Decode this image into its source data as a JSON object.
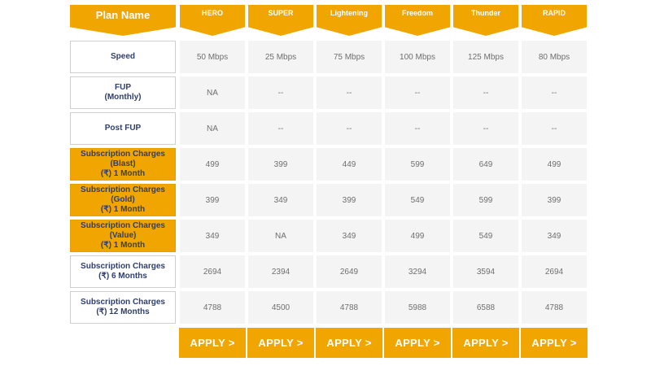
{
  "header": {
    "plan_name": "Plan Name",
    "plans": [
      "HERO",
      "SUPER",
      "Lightening",
      "Freedom",
      "Thunder",
      "RAPID"
    ]
  },
  "rows": [
    {
      "label": [
        "Speed"
      ],
      "highlight": false,
      "values": [
        "50 Mbps",
        "25 Mbps",
        "75 Mbps",
        "100 Mbps",
        "125 Mbps",
        "80 Mbps"
      ]
    },
    {
      "label": [
        "FUP",
        "(Monthly)"
      ],
      "highlight": false,
      "values": [
        "NA",
        "--",
        "--",
        "--",
        "--",
        "--"
      ]
    },
    {
      "label": [
        "Post FUP"
      ],
      "highlight": false,
      "values": [
        "NA",
        "--",
        "--",
        "--",
        "--",
        "--"
      ]
    },
    {
      "label": [
        "Subscription Charges",
        "(Blast)",
        "(₹) 1 Month"
      ],
      "highlight": true,
      "values": [
        "499",
        "399",
        "449",
        "599",
        "649",
        "499"
      ]
    },
    {
      "label": [
        "Subscription Charges",
        "(Gold)",
        "(₹) 1 Month"
      ],
      "highlight": true,
      "values": [
        "399",
        "349",
        "399",
        "549",
        "599",
        "399"
      ]
    },
    {
      "label": [
        "Subscription Charges",
        "(Value)",
        "(₹) 1 Month"
      ],
      "highlight": true,
      "values": [
        "349",
        "NA",
        "349",
        "499",
        "549",
        "349"
      ]
    },
    {
      "label": [
        "Subscription Charges",
        "(₹) 6 Months"
      ],
      "highlight": false,
      "values": [
        "2694",
        "2394",
        "2649",
        "3294",
        "3594",
        "2694"
      ]
    },
    {
      "label": [
        "Subscription Charges",
        "(₹) 12 Months"
      ],
      "highlight": false,
      "values": [
        "4788",
        "4500",
        "4788",
        "5988",
        "6588",
        "4788"
      ]
    }
  ],
  "apply_label": "APPLY >"
}
